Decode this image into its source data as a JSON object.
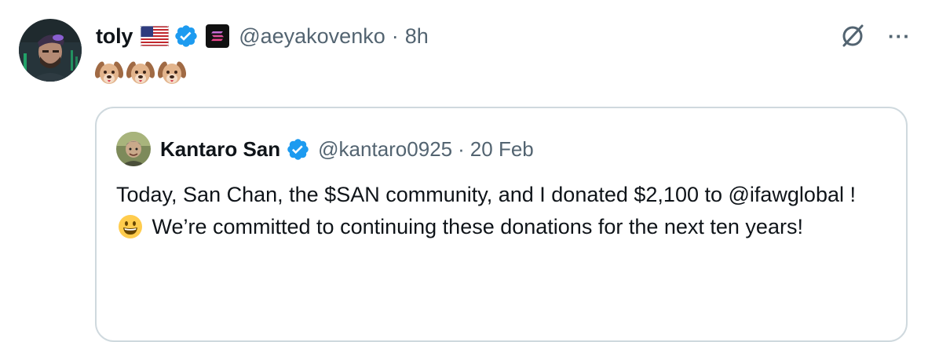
{
  "tweet": {
    "author_name": "toly",
    "handle": "@aeyakovenko",
    "separator": "·",
    "time": "8h",
    "more_label": "···",
    "emojis": [
      "dog-face-emoji",
      "dog-face-emoji",
      "dog-face-emoji"
    ]
  },
  "quoted_tweet": {
    "author_name": "Kantaro San",
    "handle": "@kantaro0925",
    "separator": "·",
    "time": "20 Feb",
    "text_part1": "Today, San Chan, the $SAN community, and I donated $2,100 to @ifawglobal  !",
    "text_part2": " We’re committed to continuing these donations for the next ten years!"
  },
  "colors": {
    "verified": "#1d9bf0",
    "secondary_text": "#536471",
    "border": "#cfd9de"
  }
}
